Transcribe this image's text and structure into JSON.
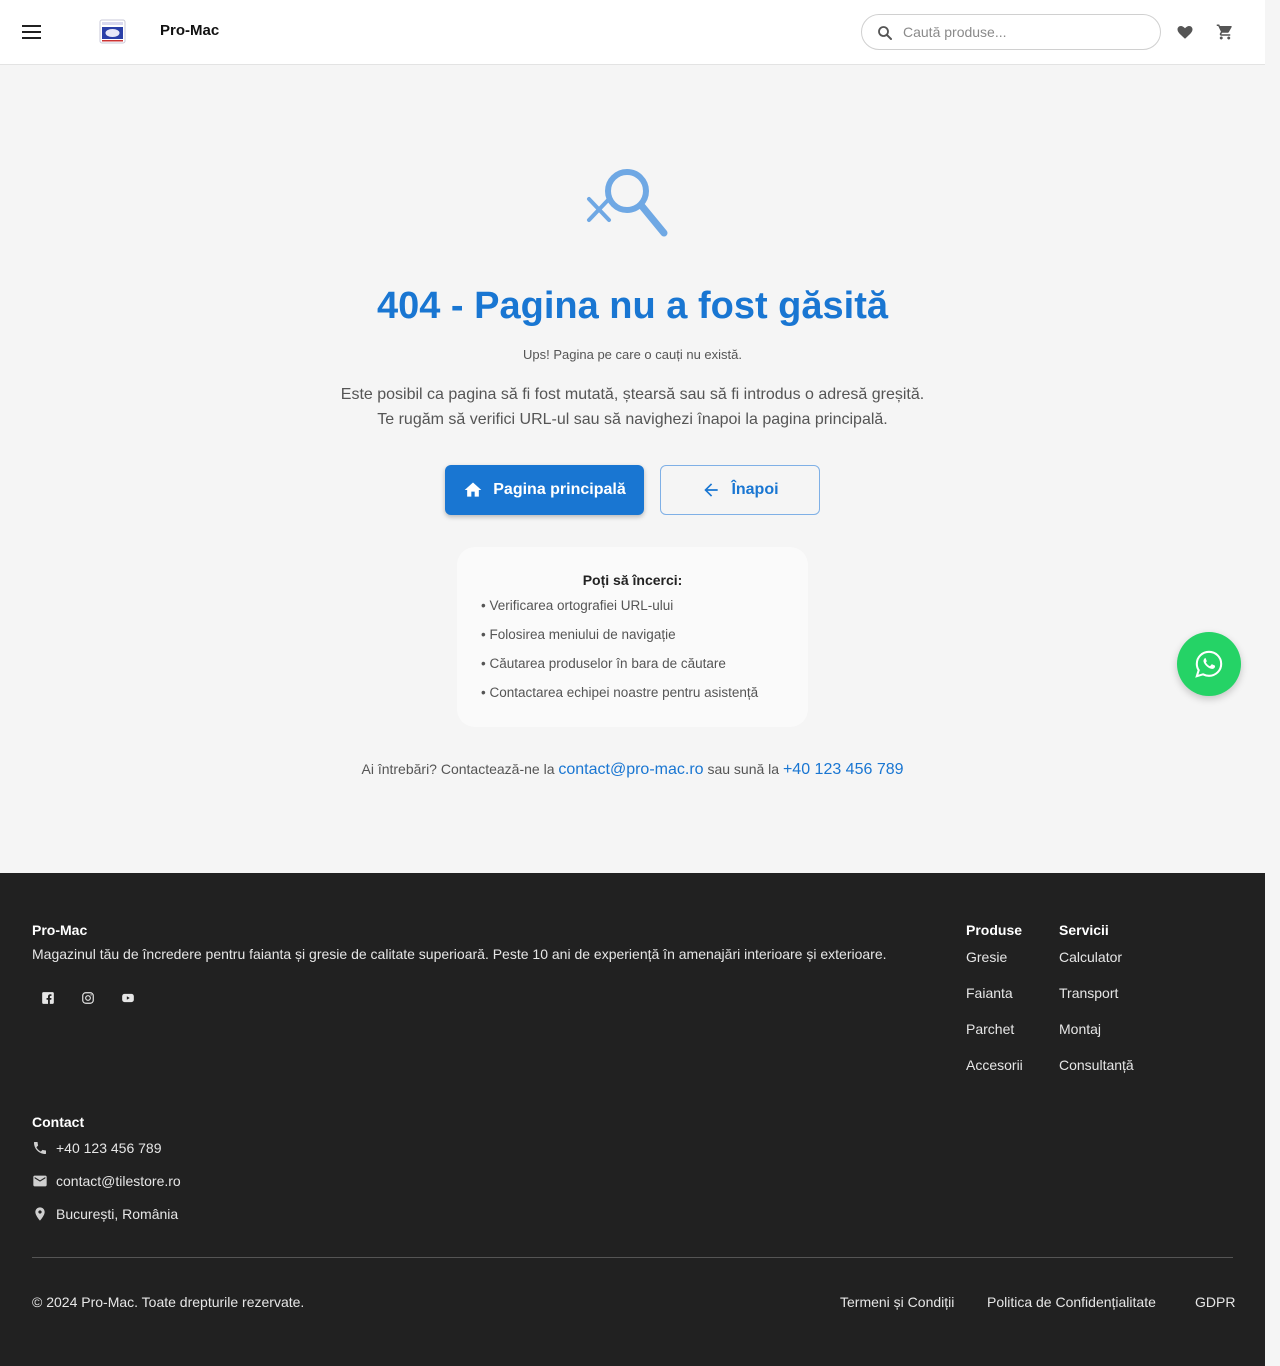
{
  "header": {
    "brand": "Pro-Mac",
    "search_placeholder": "Caută produse..."
  },
  "main": {
    "title": "404 - Pagina nu a fost găsită",
    "subtitle": "Ups! Pagina pe care o cauți nu există.",
    "description": "Este posibil ca pagina să fi fost mutată, ștearsă sau să fi introdus o adresă greșită. Te rugăm să verifici URL-ul sau să navighezi înapoi la pagina principală.",
    "home_button": "Pagina principală",
    "back_button": "Înapoi",
    "tips": {
      "title": "Poți să încerci:",
      "items": [
        "• Verificarea ortografiei URL-ului",
        "• Folosirea meniului de navigație",
        "• Căutarea produselor în bara de căutare",
        "• Contactarea echipei noastre pentru asistență"
      ]
    },
    "contact": {
      "prefix": "Ai întrebări? Contactează-ne la ",
      "email": "contact@pro-mac.ro",
      "middle": " sau sună la ",
      "phone": "+40 123 456 789"
    }
  },
  "footer": {
    "brand": "Pro-Mac",
    "description": "Magazinul tău de încredere pentru faianta și gresie de calitate superioară. Peste 10 ani de experiență în amenajări interioare și exterioare.",
    "columns": [
      {
        "heading": "Produse",
        "links": [
          "Gresie",
          "Faianta",
          "Parchet",
          "Accesorii"
        ]
      },
      {
        "heading": "Servicii",
        "links": [
          "Calculator",
          "Transport",
          "Montaj",
          "Consultanță"
        ]
      }
    ],
    "contact": {
      "heading": "Contact",
      "phone": "+40 123 456 789",
      "email": "contact@tilestore.ro",
      "address": "București, România"
    },
    "copyright": "© 2024 Pro-Mac. Toate drepturile rezervate.",
    "legal": [
      "Termeni și Condiții",
      "Politica de Confidențialitate",
      "GDPR"
    ]
  },
  "icons": {
    "menu": "menu-icon",
    "search": "search-icon",
    "favorites": "heart-icon",
    "cart": "cart-icon",
    "home": "home-icon",
    "back": "arrow-left-icon",
    "whatsapp": "whatsapp-icon",
    "social": [
      "facebook-icon",
      "instagram-icon",
      "youtube-icon"
    ]
  },
  "colors": {
    "primary": "#1976d2",
    "whatsapp": "#25d366",
    "footer_bg": "#212121"
  }
}
